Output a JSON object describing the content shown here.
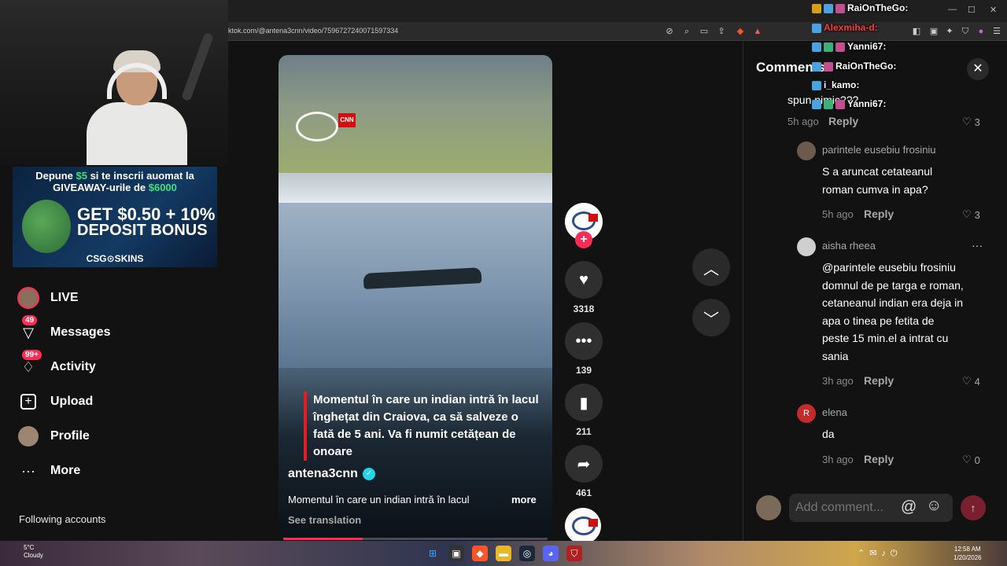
{
  "browser": {
    "url": "ktok.com/@antena3cnn/video/7596727240071597334"
  },
  "ad": {
    "line1_pre": "Depune ",
    "line1_amount": "$5",
    "line1_post": " si te inscrii auomat la",
    "line2_pre": "GIVEAWAY-urile de ",
    "line2_amount": "$6000",
    "big1": "GET $0.50 + 10%",
    "big2": "DEPOSIT BONUS",
    "brand": "CSG⊙SKINS"
  },
  "sidebar": {
    "items": [
      {
        "label": "LIVE",
        "icon": "live-avatar-icon",
        "badge": ""
      },
      {
        "label": "Messages",
        "icon": "messages-icon",
        "badge": "49"
      },
      {
        "label": "Activity",
        "icon": "activity-icon",
        "badge": "99+"
      },
      {
        "label": "Upload",
        "icon": "upload-icon",
        "badge": ""
      },
      {
        "label": "Profile",
        "icon": "profile-avatar-icon",
        "badge": ""
      },
      {
        "label": "More",
        "icon": "more-dots-icon",
        "badge": ""
      }
    ],
    "following": "Following accounts"
  },
  "video": {
    "caption": "Momentul în care un indian intră în lacul înghețat din Craiova, ca să salveze o fată de 5 ani. Va fi numit cetățean de onoare",
    "author": "antena3cnn",
    "description": "Momentul în care un indian intră în lacul",
    "more": "more",
    "see_translation": "See translation",
    "progress": 0.3,
    "logo_badge": "CNN"
  },
  "actions": {
    "likes": "3318",
    "comments": "139",
    "saves": "211",
    "shares": "461"
  },
  "comments": {
    "title": "Comments",
    "partial_text": "spun nimic???",
    "partial_time": "5h ago",
    "partial_reply": "Reply",
    "partial_likes": "3",
    "items": [
      {
        "user": "parintele eusebiu frosiniu",
        "text1": "S a aruncat cetateanul",
        "text2": "roman cumva in apa?",
        "time": "5h ago",
        "reply": "Reply",
        "likes": "3"
      },
      {
        "user": "aisha rheea",
        "lines": [
          "@parintele eusebiu frosiniu",
          "domnul de pe targa e roman,",
          "cetaneanul indian era deja in",
          "apa o tinea pe fetita de",
          "peste 15 min.el a intrat cu",
          "sania"
        ],
        "time": "3h ago",
        "reply": "Reply",
        "likes": "4"
      },
      {
        "user": "elena",
        "avatar_letter": "R",
        "text": "da",
        "time": "3h ago",
        "reply": "Reply",
        "likes": "0"
      }
    ],
    "input_placeholder": "Add comment...",
    "at_symbol": "@",
    "emoji_symbol": "☺"
  },
  "chat": [
    {
      "user": "RaiOnTheGo:",
      "color": "#ffffff"
    },
    {
      "user": "Alexmiha-d:",
      "color": "#ff3b3b"
    },
    {
      "user": "Yanni67:",
      "color": "#ffffff"
    },
    {
      "user": "RaiOnTheGo:",
      "color": "#ffffff"
    },
    {
      "user": "i_kamo:",
      "color": "#ffffff"
    },
    {
      "user": "Yanni67:",
      "color": "#ffffff"
    }
  ],
  "taskbar": {
    "weather_temp": "5°C",
    "weather_desc": "Cloudy",
    "time": "12:58 AM",
    "date": "1/20/2026"
  },
  "colors": {
    "accent": "#fe2c55",
    "verified": "#20d5ec",
    "panel_bg": "#121212"
  }
}
